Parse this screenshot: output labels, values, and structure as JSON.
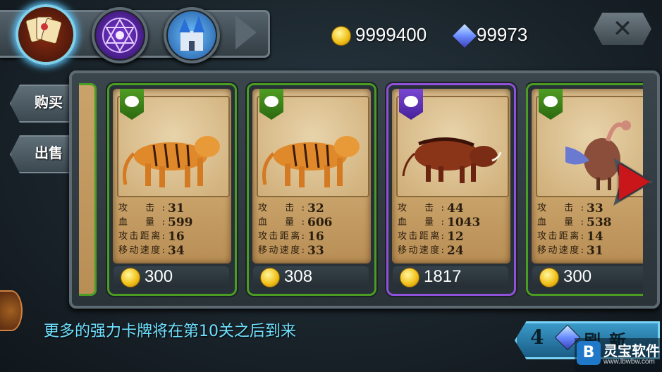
{
  "header": {
    "tabs": [
      {
        "icon": "cards-icon",
        "active": true
      },
      {
        "icon": "magic-circle-icon",
        "active": false
      },
      {
        "icon": "castle-icon",
        "active": false
      }
    ],
    "gold": "9999400",
    "gems": "99973"
  },
  "side_tabs": [
    {
      "label": "购买"
    },
    {
      "label": "出售"
    }
  ],
  "cards": [
    {
      "creature": "tiger",
      "rarity": "green",
      "stats": [
        {
          "label": "攻 击:",
          "value": "31"
        },
        {
          "label": "血 量:",
          "value": "599"
        },
        {
          "label": "攻击距离:",
          "value": "16"
        },
        {
          "label": "移动速度:",
          "value": "34"
        }
      ],
      "price": "300"
    },
    {
      "creature": "tiger",
      "rarity": "green",
      "stats": [
        {
          "label": "攻 击:",
          "value": "32"
        },
        {
          "label": "血 量:",
          "value": "606"
        },
        {
          "label": "攻击距离:",
          "value": "16"
        },
        {
          "label": "移动速度:",
          "value": "33"
        }
      ],
      "price": "308"
    },
    {
      "creature": "boar",
      "rarity": "purple",
      "stats": [
        {
          "label": "攻 击:",
          "value": "44"
        },
        {
          "label": "血 量:",
          "value": "1043"
        },
        {
          "label": "攻击距离:",
          "value": "12"
        },
        {
          "label": "移动速度:",
          "value": "24"
        }
      ],
      "price": "1817"
    },
    {
      "creature": "vulture",
      "rarity": "green",
      "stats": [
        {
          "label": "攻 击:",
          "value": "33"
        },
        {
          "label": "血 量:",
          "value": "538"
        },
        {
          "label": "攻击距离:",
          "value": "14"
        },
        {
          "label": "移动速度:",
          "value": "31"
        }
      ],
      "price": "300"
    }
  ],
  "footer": {
    "message": "更多的强力卡牌将在第10关之后到来",
    "refresh_count": "4",
    "refresh_label": "刷新"
  },
  "watermark": {
    "name": "灵宝软件",
    "url": "www.lbwbw.com"
  },
  "colors": {
    "accent": "#6fe0ff",
    "green_rarity": "#4a9c22",
    "purple_rarity": "#9150d9",
    "arrow": "#c8161b"
  }
}
